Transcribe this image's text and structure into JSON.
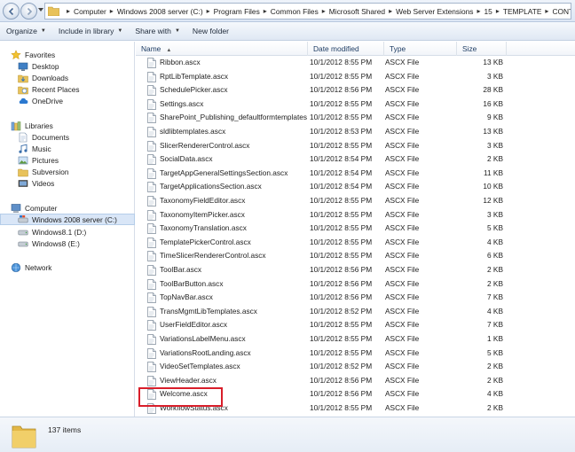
{
  "address": {
    "crumbs": [
      "Computer",
      "Windows 2008 server (C:)",
      "Program Files",
      "Common Files",
      "Microsoft Shared",
      "Web Server Extensions",
      "15",
      "TEMPLATE",
      "CONTROLTEMPLATES"
    ]
  },
  "toolbar": {
    "organize": "Organize",
    "include_in_library": "Include in library",
    "share_with": "Share with",
    "new_folder": "New folder"
  },
  "nav": {
    "favorites": "Favorites",
    "desktop": "Desktop",
    "downloads": "Downloads",
    "recent_places": "Recent Places",
    "onedrive": "OneDrive",
    "libraries": "Libraries",
    "documents": "Documents",
    "music": "Music",
    "pictures": "Pictures",
    "subversion": "Subversion",
    "videos": "Videos",
    "computer": "Computer",
    "drive_c": "Windows 2008 server (C:)",
    "drive_d": "Windows8.1 (D:)",
    "drive_e": "Windows8 (E:)",
    "network": "Network"
  },
  "columns": {
    "name": "Name",
    "date_modified": "Date modified",
    "type": "Type",
    "size": "Size"
  },
  "files": [
    {
      "name": "Ribbon.ascx",
      "date": "10/1/2012 8:55 PM",
      "type": "ASCX File",
      "size": "13 KB"
    },
    {
      "name": "RptLibTemplate.ascx",
      "date": "10/1/2012 8:55 PM",
      "type": "ASCX File",
      "size": "3 KB"
    },
    {
      "name": "SchedulePicker.ascx",
      "date": "10/1/2012 8:56 PM",
      "type": "ASCX File",
      "size": "28 KB"
    },
    {
      "name": "Settings.ascx",
      "date": "10/1/2012 8:55 PM",
      "type": "ASCX File",
      "size": "16 KB"
    },
    {
      "name": "SharePoint_Publishing_defaultformtemplates....",
      "date": "10/1/2012 8:55 PM",
      "type": "ASCX File",
      "size": "9 KB"
    },
    {
      "name": "sldlibtemplates.ascx",
      "date": "10/1/2012 8:53 PM",
      "type": "ASCX File",
      "size": "13 KB"
    },
    {
      "name": "SlicerRendererControl.ascx",
      "date": "10/1/2012 8:55 PM",
      "type": "ASCX File",
      "size": "3 KB"
    },
    {
      "name": "SocialData.ascx",
      "date": "10/1/2012 8:54 PM",
      "type": "ASCX File",
      "size": "2 KB"
    },
    {
      "name": "TargetAppGeneralSettingsSection.ascx",
      "date": "10/1/2012 8:54 PM",
      "type": "ASCX File",
      "size": "11 KB"
    },
    {
      "name": "TargetApplicationsSection.ascx",
      "date": "10/1/2012 8:54 PM",
      "type": "ASCX File",
      "size": "10 KB"
    },
    {
      "name": "TaxonomyFieldEditor.ascx",
      "date": "10/1/2012 8:55 PM",
      "type": "ASCX File",
      "size": "12 KB"
    },
    {
      "name": "TaxonomyItemPicker.ascx",
      "date": "10/1/2012 8:55 PM",
      "type": "ASCX File",
      "size": "3 KB"
    },
    {
      "name": "TaxonomyTranslation.ascx",
      "date": "10/1/2012 8:55 PM",
      "type": "ASCX File",
      "size": "5 KB"
    },
    {
      "name": "TemplatePickerControl.ascx",
      "date": "10/1/2012 8:55 PM",
      "type": "ASCX File",
      "size": "4 KB"
    },
    {
      "name": "TimeSlicerRendererControl.ascx",
      "date": "10/1/2012 8:55 PM",
      "type": "ASCX File",
      "size": "6 KB"
    },
    {
      "name": "ToolBar.ascx",
      "date": "10/1/2012 8:56 PM",
      "type": "ASCX File",
      "size": "2 KB"
    },
    {
      "name": "ToolBarButton.ascx",
      "date": "10/1/2012 8:56 PM",
      "type": "ASCX File",
      "size": "2 KB"
    },
    {
      "name": "TopNavBar.ascx",
      "date": "10/1/2012 8:56 PM",
      "type": "ASCX File",
      "size": "7 KB"
    },
    {
      "name": "TransMgmtLibTemplates.ascx",
      "date": "10/1/2012 8:52 PM",
      "type": "ASCX File",
      "size": "4 KB"
    },
    {
      "name": "UserFieldEditor.ascx",
      "date": "10/1/2012 8:55 PM",
      "type": "ASCX File",
      "size": "7 KB"
    },
    {
      "name": "VariationsLabelMenu.ascx",
      "date": "10/1/2012 8:55 PM",
      "type": "ASCX File",
      "size": "1 KB"
    },
    {
      "name": "VariationsRootLanding.ascx",
      "date": "10/1/2012 8:55 PM",
      "type": "ASCX File",
      "size": "5 KB"
    },
    {
      "name": "VideoSetTemplates.ascx",
      "date": "10/1/2012 8:52 PM",
      "type": "ASCX File",
      "size": "2 KB"
    },
    {
      "name": "ViewHeader.ascx",
      "date": "10/1/2012 8:56 PM",
      "type": "ASCX File",
      "size": "2 KB"
    },
    {
      "name": "Welcome.ascx",
      "date": "10/1/2012 8:56 PM",
      "type": "ASCX File",
      "size": "4 KB"
    },
    {
      "name": "WorkflowStatus.ascx",
      "date": "10/1/2012 8:55 PM",
      "type": "ASCX File",
      "size": "2 KB"
    }
  ],
  "status": {
    "item_count": "137 items"
  },
  "colors": {
    "highlight_box": "#d81e2a",
    "selection": "#d9e6f7"
  }
}
